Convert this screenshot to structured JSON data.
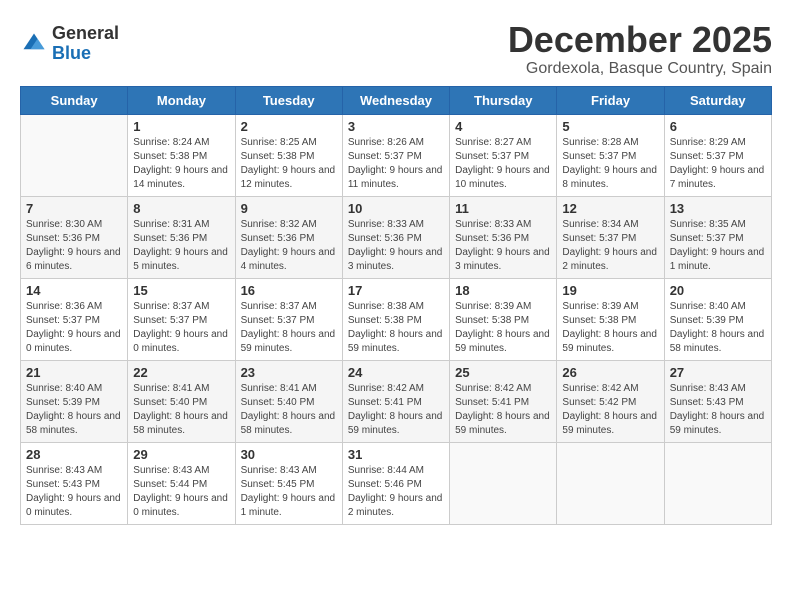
{
  "header": {
    "logo": {
      "general": "General",
      "blue": "Blue"
    },
    "title": "December 2025",
    "location": "Gordexola, Basque Country, Spain"
  },
  "calendar": {
    "days_of_week": [
      "Sunday",
      "Monday",
      "Tuesday",
      "Wednesday",
      "Thursday",
      "Friday",
      "Saturday"
    ],
    "weeks": [
      [
        {
          "day": "",
          "empty": true
        },
        {
          "day": "1",
          "sunrise": "Sunrise: 8:24 AM",
          "sunset": "Sunset: 5:38 PM",
          "daylight": "Daylight: 9 hours and 14 minutes."
        },
        {
          "day": "2",
          "sunrise": "Sunrise: 8:25 AM",
          "sunset": "Sunset: 5:38 PM",
          "daylight": "Daylight: 9 hours and 12 minutes."
        },
        {
          "day": "3",
          "sunrise": "Sunrise: 8:26 AM",
          "sunset": "Sunset: 5:37 PM",
          "daylight": "Daylight: 9 hours and 11 minutes."
        },
        {
          "day": "4",
          "sunrise": "Sunrise: 8:27 AM",
          "sunset": "Sunset: 5:37 PM",
          "daylight": "Daylight: 9 hours and 10 minutes."
        },
        {
          "day": "5",
          "sunrise": "Sunrise: 8:28 AM",
          "sunset": "Sunset: 5:37 PM",
          "daylight": "Daylight: 9 hours and 8 minutes."
        },
        {
          "day": "6",
          "sunrise": "Sunrise: 8:29 AM",
          "sunset": "Sunset: 5:37 PM",
          "daylight": "Daylight: 9 hours and 7 minutes."
        }
      ],
      [
        {
          "day": "7",
          "sunrise": "Sunrise: 8:30 AM",
          "sunset": "Sunset: 5:36 PM",
          "daylight": "Daylight: 9 hours and 6 minutes."
        },
        {
          "day": "8",
          "sunrise": "Sunrise: 8:31 AM",
          "sunset": "Sunset: 5:36 PM",
          "daylight": "Daylight: 9 hours and 5 minutes."
        },
        {
          "day": "9",
          "sunrise": "Sunrise: 8:32 AM",
          "sunset": "Sunset: 5:36 PM",
          "daylight": "Daylight: 9 hours and 4 minutes."
        },
        {
          "day": "10",
          "sunrise": "Sunrise: 8:33 AM",
          "sunset": "Sunset: 5:36 PM",
          "daylight": "Daylight: 9 hours and 3 minutes."
        },
        {
          "day": "11",
          "sunrise": "Sunrise: 8:33 AM",
          "sunset": "Sunset: 5:36 PM",
          "daylight": "Daylight: 9 hours and 3 minutes."
        },
        {
          "day": "12",
          "sunrise": "Sunrise: 8:34 AM",
          "sunset": "Sunset: 5:37 PM",
          "daylight": "Daylight: 9 hours and 2 minutes."
        },
        {
          "day": "13",
          "sunrise": "Sunrise: 8:35 AM",
          "sunset": "Sunset: 5:37 PM",
          "daylight": "Daylight: 9 hours and 1 minute."
        }
      ],
      [
        {
          "day": "14",
          "sunrise": "Sunrise: 8:36 AM",
          "sunset": "Sunset: 5:37 PM",
          "daylight": "Daylight: 9 hours and 0 minutes."
        },
        {
          "day": "15",
          "sunrise": "Sunrise: 8:37 AM",
          "sunset": "Sunset: 5:37 PM",
          "daylight": "Daylight: 9 hours and 0 minutes."
        },
        {
          "day": "16",
          "sunrise": "Sunrise: 8:37 AM",
          "sunset": "Sunset: 5:37 PM",
          "daylight": "Daylight: 8 hours and 59 minutes."
        },
        {
          "day": "17",
          "sunrise": "Sunrise: 8:38 AM",
          "sunset": "Sunset: 5:38 PM",
          "daylight": "Daylight: 8 hours and 59 minutes."
        },
        {
          "day": "18",
          "sunrise": "Sunrise: 8:39 AM",
          "sunset": "Sunset: 5:38 PM",
          "daylight": "Daylight: 8 hours and 59 minutes."
        },
        {
          "day": "19",
          "sunrise": "Sunrise: 8:39 AM",
          "sunset": "Sunset: 5:38 PM",
          "daylight": "Daylight: 8 hours and 59 minutes."
        },
        {
          "day": "20",
          "sunrise": "Sunrise: 8:40 AM",
          "sunset": "Sunset: 5:39 PM",
          "daylight": "Daylight: 8 hours and 58 minutes."
        }
      ],
      [
        {
          "day": "21",
          "sunrise": "Sunrise: 8:40 AM",
          "sunset": "Sunset: 5:39 PM",
          "daylight": "Daylight: 8 hours and 58 minutes."
        },
        {
          "day": "22",
          "sunrise": "Sunrise: 8:41 AM",
          "sunset": "Sunset: 5:40 PM",
          "daylight": "Daylight: 8 hours and 58 minutes."
        },
        {
          "day": "23",
          "sunrise": "Sunrise: 8:41 AM",
          "sunset": "Sunset: 5:40 PM",
          "daylight": "Daylight: 8 hours and 58 minutes."
        },
        {
          "day": "24",
          "sunrise": "Sunrise: 8:42 AM",
          "sunset": "Sunset: 5:41 PM",
          "daylight": "Daylight: 8 hours and 59 minutes."
        },
        {
          "day": "25",
          "sunrise": "Sunrise: 8:42 AM",
          "sunset": "Sunset: 5:41 PM",
          "daylight": "Daylight: 8 hours and 59 minutes."
        },
        {
          "day": "26",
          "sunrise": "Sunrise: 8:42 AM",
          "sunset": "Sunset: 5:42 PM",
          "daylight": "Daylight: 8 hours and 59 minutes."
        },
        {
          "day": "27",
          "sunrise": "Sunrise: 8:43 AM",
          "sunset": "Sunset: 5:43 PM",
          "daylight": "Daylight: 8 hours and 59 minutes."
        }
      ],
      [
        {
          "day": "28",
          "sunrise": "Sunrise: 8:43 AM",
          "sunset": "Sunset: 5:43 PM",
          "daylight": "Daylight: 9 hours and 0 minutes."
        },
        {
          "day": "29",
          "sunrise": "Sunrise: 8:43 AM",
          "sunset": "Sunset: 5:44 PM",
          "daylight": "Daylight: 9 hours and 0 minutes."
        },
        {
          "day": "30",
          "sunrise": "Sunrise: 8:43 AM",
          "sunset": "Sunset: 5:45 PM",
          "daylight": "Daylight: 9 hours and 1 minute."
        },
        {
          "day": "31",
          "sunrise": "Sunrise: 8:44 AM",
          "sunset": "Sunset: 5:46 PM",
          "daylight": "Daylight: 9 hours and 2 minutes."
        },
        {
          "day": "",
          "empty": true
        },
        {
          "day": "",
          "empty": true
        },
        {
          "day": "",
          "empty": true
        }
      ]
    ]
  }
}
